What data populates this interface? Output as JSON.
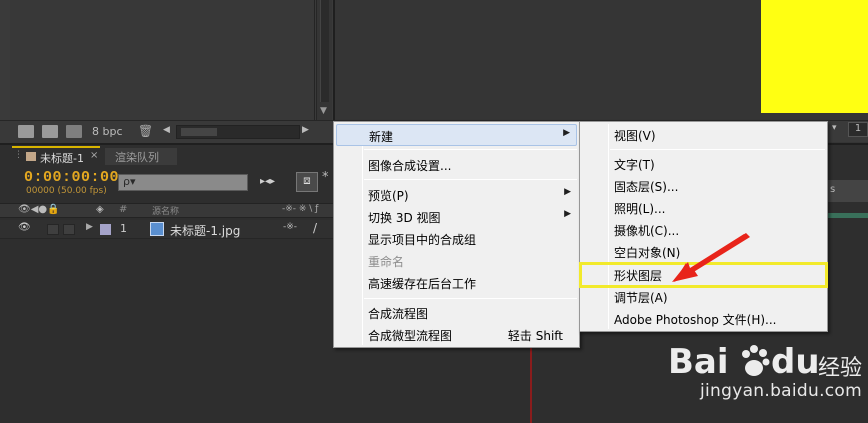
{
  "project_panel": {
    "bpc_label": "8 bpc"
  },
  "timeline": {
    "comp_tab_label": "未标题-1",
    "comp_tab_close": "×",
    "render_queue_tab": "渲染队列",
    "timecode": "0:00:00:00",
    "fps_label": "00000 (50.00 fps)",
    "search_placeholder": "ρ▾",
    "columns": {
      "hash": "#",
      "source_name": "源名称"
    },
    "layer": {
      "number": "1",
      "name": "未标题-1.jpg"
    },
    "right_strip_label": "s"
  },
  "viewer": {
    "zoom": "1"
  },
  "context_menu": {
    "items": [
      {
        "label": "新建",
        "submenu": true,
        "hover": true
      },
      {
        "separator": true
      },
      {
        "label": "图像合成设置..."
      },
      {
        "separator": true
      },
      {
        "label": "预览(P)",
        "submenu": true
      },
      {
        "label": "切换 3D 视图",
        "submenu": true
      },
      {
        "label": "显示项目中的合成组"
      },
      {
        "label": "重命名",
        "disabled": true
      },
      {
        "label": "高速缓存在后台工作"
      },
      {
        "separator": true
      },
      {
        "label": "合成流程图"
      },
      {
        "label": "合成微型流程图",
        "shortcut": "轻击 Shift"
      }
    ]
  },
  "submenu": {
    "items": [
      {
        "label": "视图(V)"
      },
      {
        "separator": true
      },
      {
        "label": "文字(T)"
      },
      {
        "label": "固态层(S)..."
      },
      {
        "label": "照明(L)..."
      },
      {
        "label": "摄像机(C)..."
      },
      {
        "label": "空白对象(N)"
      },
      {
        "label": "形状图层",
        "highlighted": true
      },
      {
        "label": "调节层(A)"
      },
      {
        "label": "Adobe Photoshop 文件(H)..."
      }
    ]
  },
  "annotation": {
    "highlight_color": "#f2ea2b",
    "arrow_color": "#e8241a"
  },
  "watermark": {
    "brand_bai": "Bai",
    "brand_du": "du",
    "brand_jingyan": "经验",
    "url": "jingyan.baidu.com"
  },
  "colors": {
    "timecode": "#e4a820",
    "comp_yellow": "#ffff12",
    "menu_bg": "#f0f0f0",
    "panel_bg": "#2e2e2e"
  }
}
